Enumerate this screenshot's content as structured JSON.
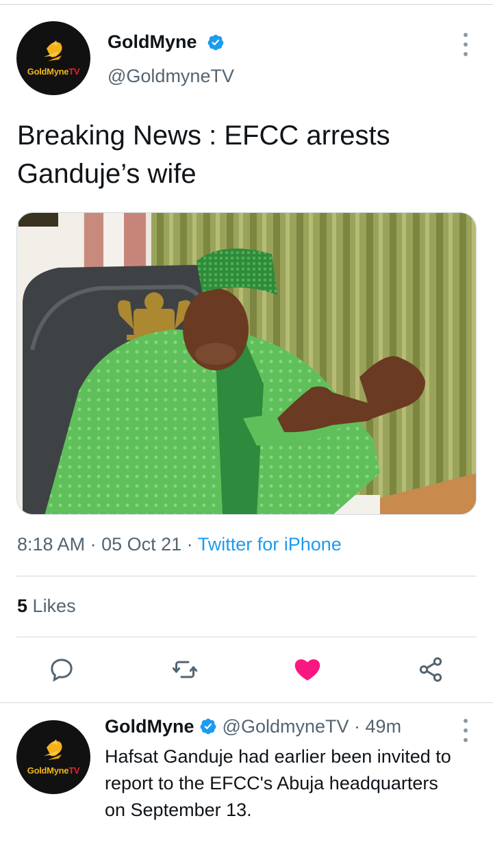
{
  "tweet": {
    "author_name": "GoldMyne",
    "author_handle": "@GoldmyneTV",
    "avatar_logo_text": "GoldMyne",
    "avatar_logo_tv": "TV",
    "text": "Breaking News : EFCC arrests Ganduje’s wife",
    "time": "8:18 AM",
    "date": "05 Oct 21",
    "source": "Twitter for iPhone",
    "likes_count": "5",
    "likes_label": "Likes",
    "liked": true
  },
  "reply": {
    "author_name": "GoldMyne",
    "author_handle": "@GoldmyneTV",
    "age": "49m",
    "text": "Hafsat Ganduje had earlier been invited to report to the EFCC's Abuja headquarters on September 13."
  },
  "colors": {
    "link": "#1d9bf0",
    "like_active": "#f91880",
    "secondary_text": "#536471",
    "divider": "#cfd9de"
  },
  "icons": [
    "verified-badge-icon",
    "more-options-icon",
    "reply-icon",
    "retweet-icon",
    "like-heart-icon",
    "share-icon"
  ]
}
